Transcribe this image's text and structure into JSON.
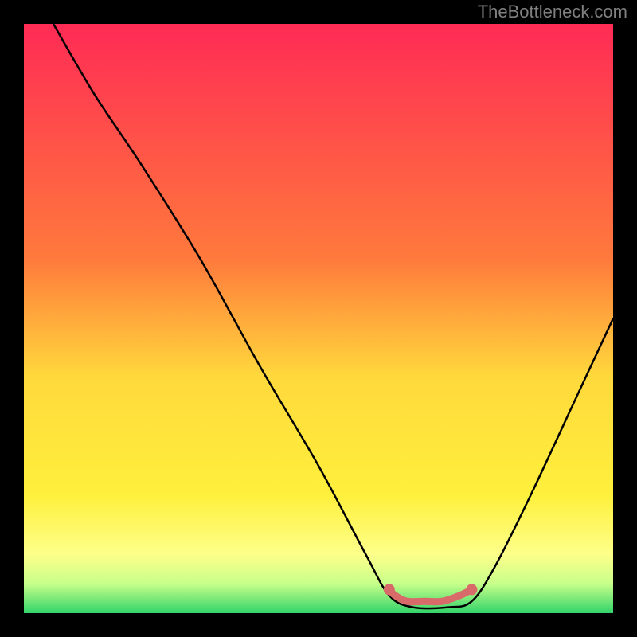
{
  "watermark": "TheBottleneck.com",
  "chart_data": {
    "type": "line",
    "title": "",
    "xlabel": "",
    "ylabel": "",
    "xlim": [
      0,
      100
    ],
    "ylim": [
      0,
      100
    ],
    "gradient_stops": [
      {
        "offset": 0,
        "color": "#ff2b55"
      },
      {
        "offset": 40,
        "color": "#ff7a3c"
      },
      {
        "offset": 60,
        "color": "#ffd93c"
      },
      {
        "offset": 80,
        "color": "#fff03c"
      },
      {
        "offset": 90,
        "color": "#fdff8a"
      },
      {
        "offset": 95,
        "color": "#c8ff8a"
      },
      {
        "offset": 100,
        "color": "#32d46a"
      }
    ],
    "series": [
      {
        "name": "curve",
        "color": "#000000",
        "points": [
          {
            "x": 5,
            "y": 100
          },
          {
            "x": 12,
            "y": 88
          },
          {
            "x": 20,
            "y": 76
          },
          {
            "x": 30,
            "y": 60
          },
          {
            "x": 40,
            "y": 42
          },
          {
            "x": 50,
            "y": 25
          },
          {
            "x": 58,
            "y": 10
          },
          {
            "x": 62,
            "y": 3
          },
          {
            "x": 66,
            "y": 1
          },
          {
            "x": 72,
            "y": 1
          },
          {
            "x": 76,
            "y": 2
          },
          {
            "x": 80,
            "y": 8
          },
          {
            "x": 86,
            "y": 20
          },
          {
            "x": 93,
            "y": 35
          },
          {
            "x": 100,
            "y": 50
          }
        ]
      }
    ],
    "highlight": {
      "color": "#d86a6a",
      "points": [
        {
          "x": 62,
          "y": 4
        },
        {
          "x": 63,
          "y": 3
        },
        {
          "x": 65,
          "y": 2
        },
        {
          "x": 68,
          "y": 2
        },
        {
          "x": 71,
          "y": 2
        },
        {
          "x": 74,
          "y": 3
        },
        {
          "x": 76,
          "y": 4
        }
      ],
      "endpoints": [
        {
          "x": 62,
          "y": 4
        },
        {
          "x": 76,
          "y": 4
        }
      ]
    }
  }
}
